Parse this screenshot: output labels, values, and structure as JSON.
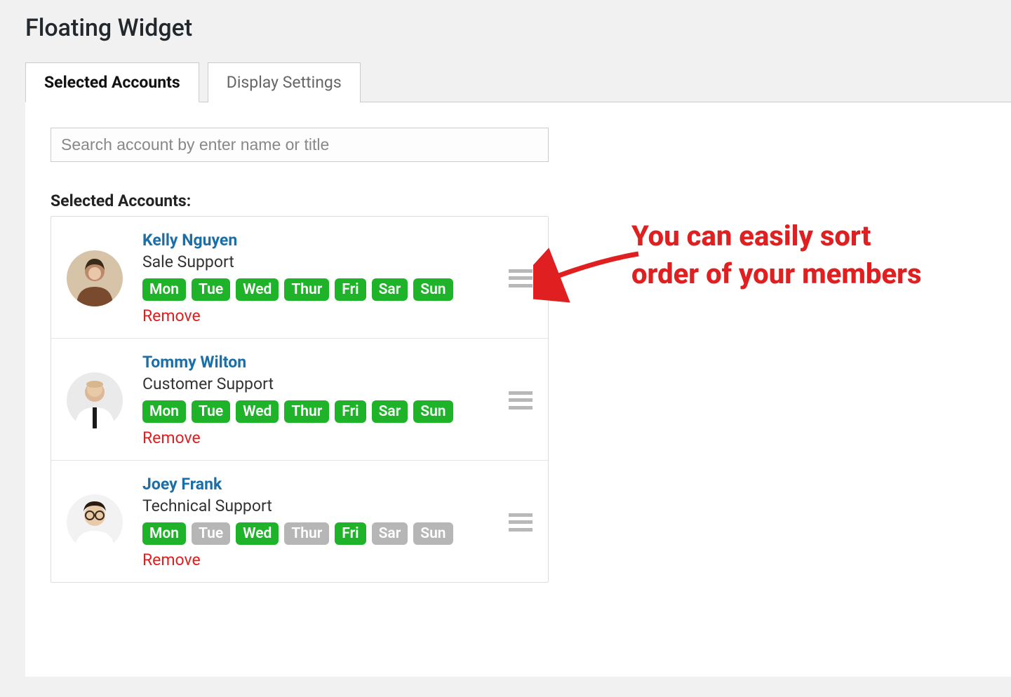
{
  "page_title": "Floating Widget",
  "tabs": [
    {
      "label": "Selected Accounts",
      "active": true
    },
    {
      "label": "Display Settings",
      "active": false
    }
  ],
  "search": {
    "placeholder": "Search account by enter name or title"
  },
  "section_label": "Selected Accounts:",
  "remove_label": "Remove",
  "day_labels": [
    "Mon",
    "Tue",
    "Wed",
    "Thur",
    "Fri",
    "Sar",
    "Sun"
  ],
  "accounts": [
    {
      "name": "Kelly Nguyen",
      "role": "Sale Support",
      "days_active": [
        true,
        true,
        true,
        true,
        true,
        true,
        true
      ],
      "avatar_bg": "#c9a178"
    },
    {
      "name": "Tommy Wilton",
      "role": "Customer Support",
      "days_active": [
        true,
        true,
        true,
        true,
        true,
        true,
        true
      ],
      "avatar_bg": "#dedede"
    },
    {
      "name": "Joey Frank",
      "role": "Technical Support",
      "days_active": [
        true,
        false,
        true,
        false,
        true,
        false,
        false
      ],
      "avatar_bg": "#e8e8e8"
    }
  ],
  "annotation_text": "You can easily sort order of your members",
  "colors": {
    "accent_link": "#1b6fa8",
    "badge_active": "#1fb32a",
    "badge_inactive": "#b6b6b6",
    "remove": "#e11d1d",
    "annotation": "#e02020"
  }
}
